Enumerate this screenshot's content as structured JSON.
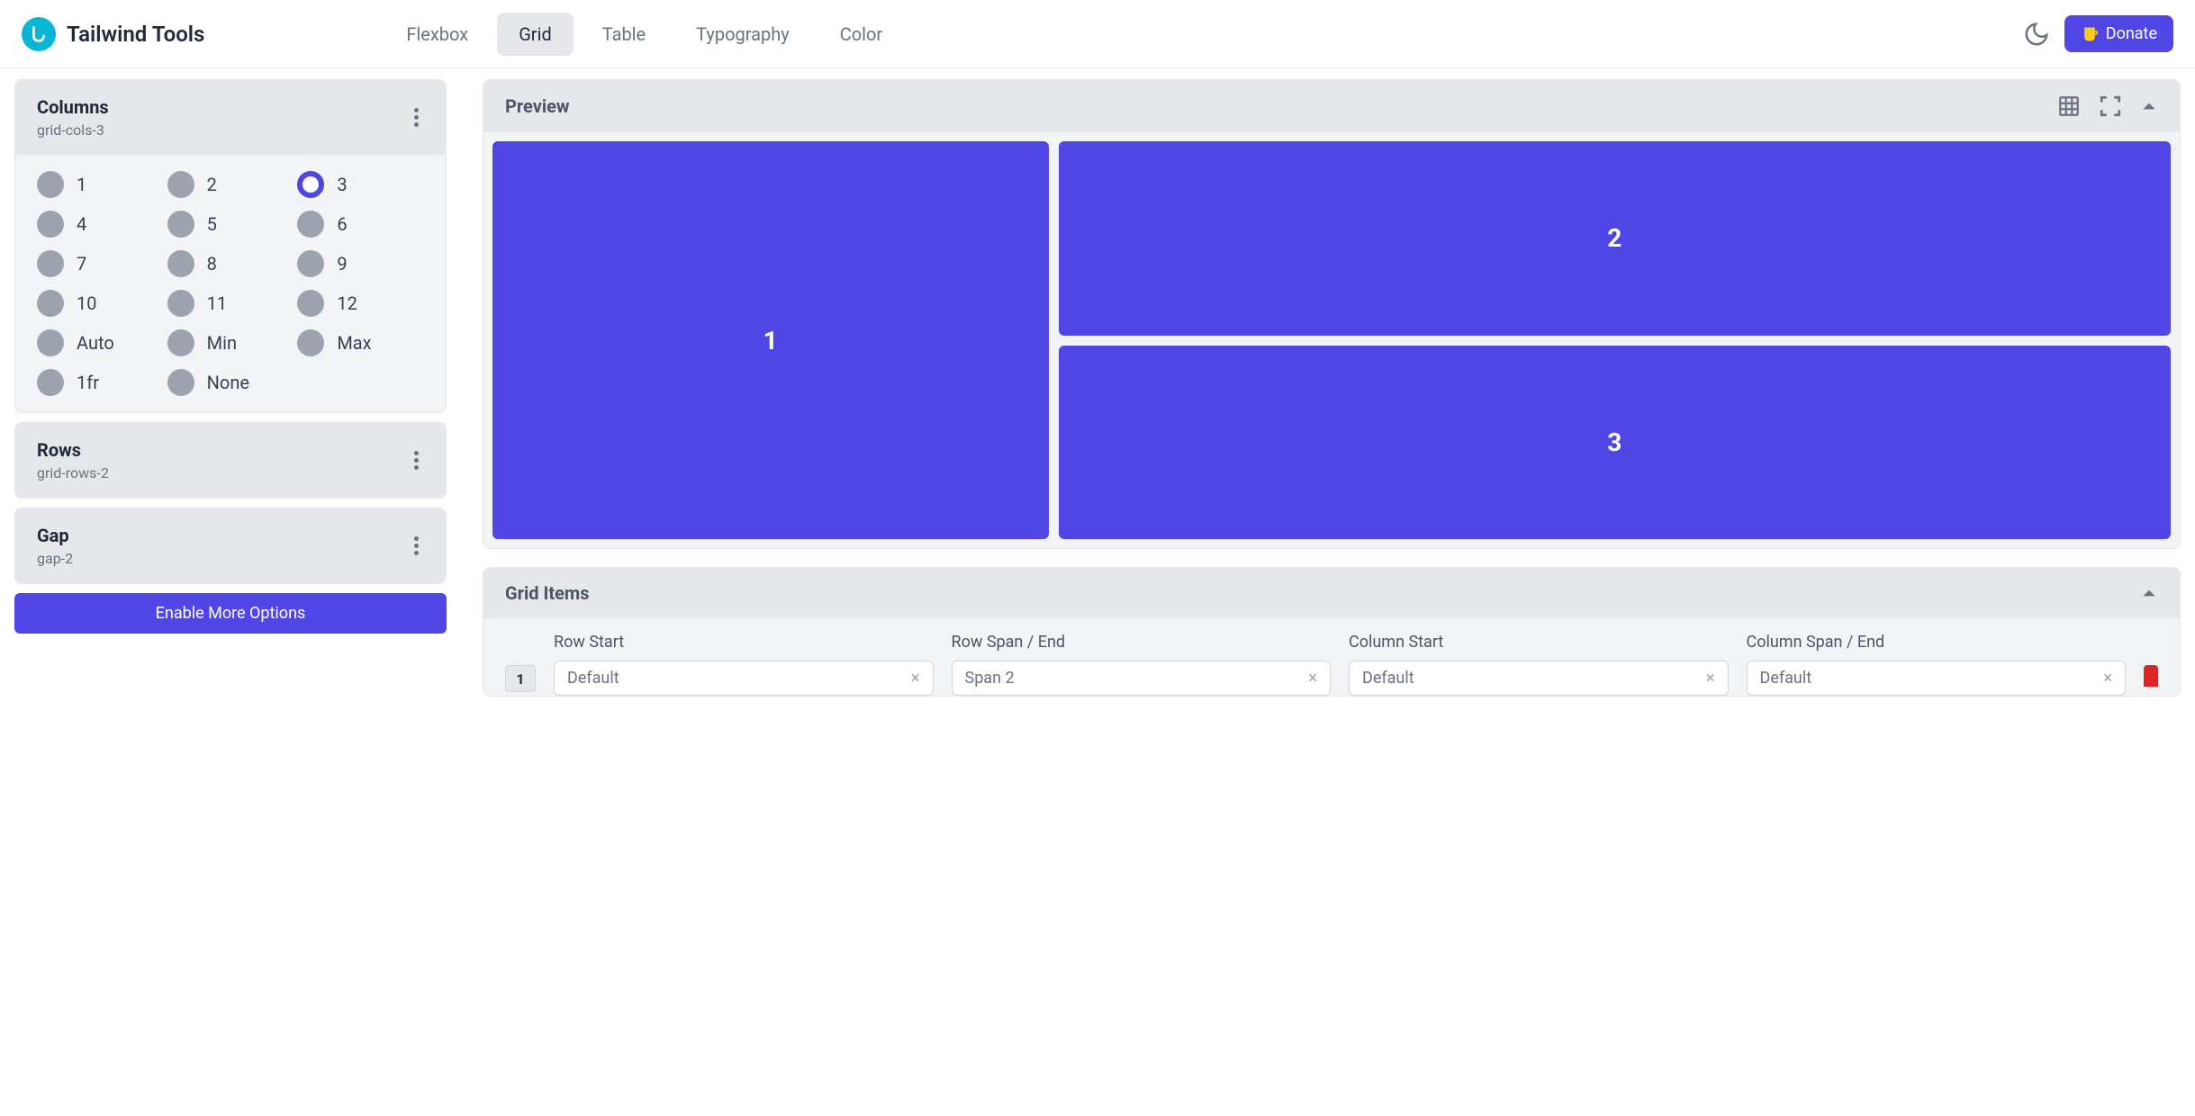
{
  "header": {
    "app_name": "Tailwind Tools",
    "nav": {
      "flexbox": "Flexbox",
      "grid": "Grid",
      "table": "Table",
      "typography": "Typography",
      "color": "Color"
    },
    "donate": "Donate"
  },
  "sidebar": {
    "columns": {
      "title": "Columns",
      "subtitle": "grid-cols-3",
      "options": {
        "o1": "1",
        "o2": "2",
        "o3": "3",
        "o4": "4",
        "o5": "5",
        "o6": "6",
        "o7": "7",
        "o8": "8",
        "o9": "9",
        "o10": "10",
        "o11": "11",
        "o12": "12",
        "auto": "Auto",
        "min": "Min",
        "max": "Max",
        "fr": "1fr",
        "none": "None"
      },
      "selected": "3"
    },
    "rows": {
      "title": "Rows",
      "subtitle": "grid-rows-2"
    },
    "gap": {
      "title": "Gap",
      "subtitle": "gap-2"
    },
    "enable_more": "Enable More Options"
  },
  "preview": {
    "title": "Preview",
    "cells": {
      "c1": "1",
      "c2": "2",
      "c3": "3"
    }
  },
  "grid_items": {
    "title": "Grid Items",
    "item_number": "1",
    "labels": {
      "row_start": "Row Start",
      "row_span": "Row Span / End",
      "col_start": "Column Start",
      "col_span": "Column Span / End"
    },
    "values": {
      "row_start": "Default",
      "row_span": "Span 2",
      "col_start": "Default",
      "col_span": "Default"
    }
  }
}
